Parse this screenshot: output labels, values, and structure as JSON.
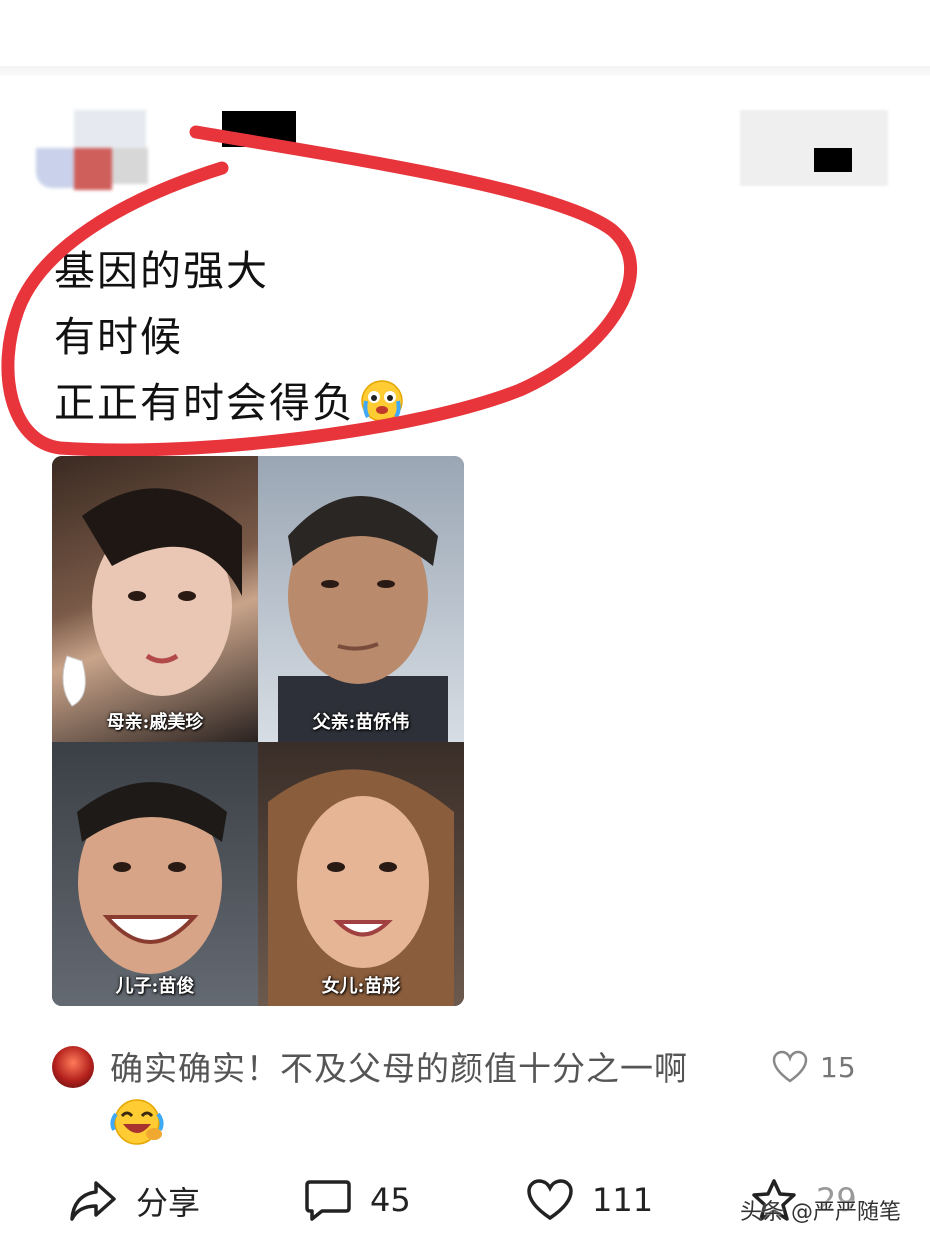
{
  "post": {
    "lines": [
      "基因的强大",
      "有时候",
      "正正有时会得负"
    ]
  },
  "photos": [
    {
      "caption": "母亲:戚美珍"
    },
    {
      "caption": "父亲:苗侨伟"
    },
    {
      "caption": "儿子:苗俊"
    },
    {
      "caption": "女儿:苗彤"
    }
  ],
  "comment": {
    "text": "确实确实！不及父母的颜值十分之一啊",
    "likes": "15"
  },
  "actions": {
    "share_label": "分享",
    "comments_count": "45",
    "likes_count": "111",
    "favorites_count": "29"
  },
  "watermark": "头条 @严严随笔",
  "colors": {
    "annotation_red": "#e8353b",
    "text": "#111111",
    "muted": "#777777"
  },
  "icons": [
    "share-icon",
    "comment-icon",
    "heart-icon",
    "star-icon"
  ]
}
